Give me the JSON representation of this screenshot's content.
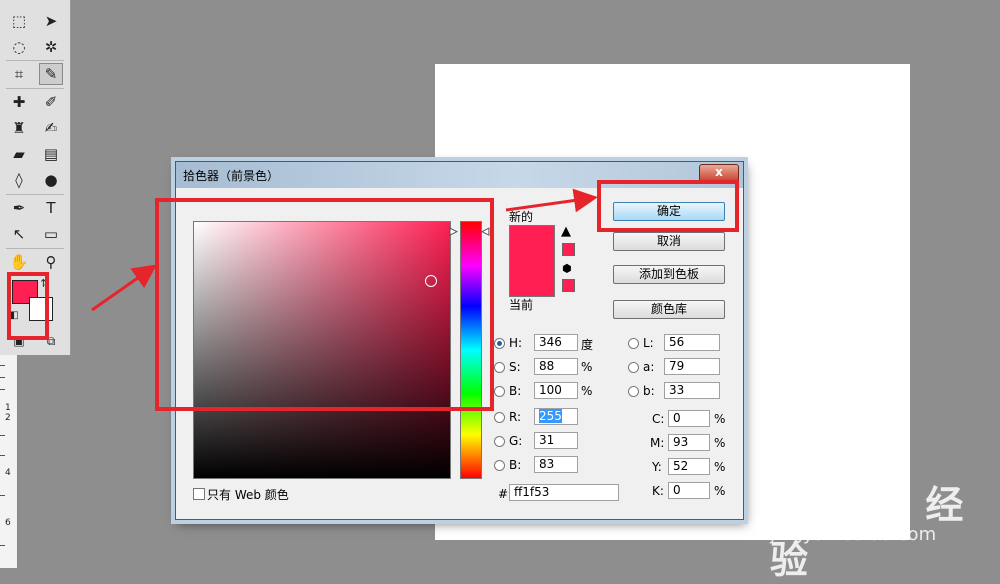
{
  "dialog": {
    "title": "拾色器（前景色）",
    "close_label": "x",
    "new_label": "新的",
    "current_label": "当前",
    "ok_label": "确定",
    "cancel_label": "取消",
    "add_swatch_label": "添加到色板",
    "color_library_label": "颜色库",
    "web_only_label": "只有 Web 颜色",
    "fields": {
      "H": {
        "label": "H:",
        "value": "346",
        "unit": "度"
      },
      "S": {
        "label": "S:",
        "value": "88",
        "unit": "%"
      },
      "Bv": {
        "label": "B:",
        "value": "100",
        "unit": "%"
      },
      "R": {
        "label": "R:",
        "value": "255"
      },
      "G": {
        "label": "G:",
        "value": "31"
      },
      "Bl": {
        "label": "B:",
        "value": "83"
      },
      "L": {
        "label": "L:",
        "value": "56"
      },
      "a": {
        "label": "a:",
        "value": "79"
      },
      "b": {
        "label": "b:",
        "value": "33"
      },
      "C": {
        "label": "C:",
        "value": "0",
        "unit": "%"
      },
      "M": {
        "label": "M:",
        "value": "93",
        "unit": "%"
      },
      "Y": {
        "label": "Y:",
        "value": "52",
        "unit": "%"
      },
      "K": {
        "label": "K:",
        "value": "0",
        "unit": "%"
      },
      "hex_label": "#",
      "hex": "ff1f53"
    },
    "selected_color": "#ff1f53",
    "selected_radio": "H"
  },
  "toolbar": {
    "foreground_color": "#ff1f53",
    "background_color": "#ffffff",
    "tools": [
      "marquee-icon",
      "move-icon",
      "lasso-icon",
      "magic-wand-icon",
      "crop-icon",
      "eyedropper-icon",
      "healing-icon",
      "brush-icon",
      "stamp-icon",
      "history-brush-icon",
      "eraser-icon",
      "gradient-icon",
      "blur-icon",
      "dodge-icon",
      "pen-icon",
      "type-icon",
      "path-select-icon",
      "shape-icon",
      "hand-icon",
      "zoom-icon"
    ],
    "ruler_marks": [
      "1",
      "2",
      "4",
      "6"
    ]
  },
  "watermark": {
    "logo": "Bai du 经验",
    "url": "jingyan.baidu.com"
  },
  "annotation_color": "#e5242b"
}
